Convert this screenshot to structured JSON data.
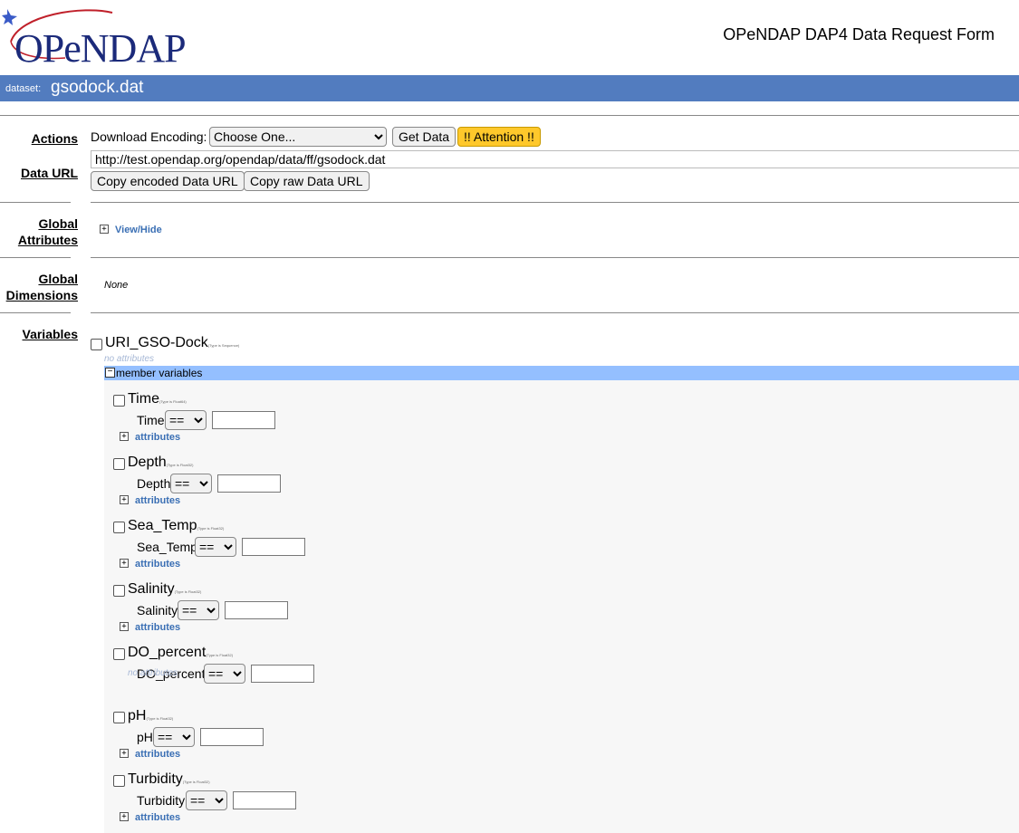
{
  "header": {
    "logo_text": "OPeNDAP",
    "form_title": "OPeNDAP DAP4 Data Request Form"
  },
  "dataset": {
    "label": "dataset:",
    "name": "gsodock.dat"
  },
  "sections": {
    "actions": "Actions",
    "data_url": "Data URL",
    "global_attributes_line1": "Global",
    "global_attributes_line2": "Attributes",
    "global_dimensions_line1": "Global",
    "global_dimensions_line2": "Dimensions",
    "variables": "Variables"
  },
  "actions": {
    "download_encoding_label": "Download Encoding:",
    "encoding_selected": "Choose One...",
    "get_data": "Get Data",
    "attention": "!! Attention !!"
  },
  "data_url": {
    "value": "http://test.opendap.org/opendap/data/ff/gsodock.dat",
    "copy_encoded": "Copy encoded Data URL",
    "copy_raw": "Copy raw Data URL"
  },
  "global_attributes": {
    "toggle_label": "View/Hide",
    "plus": "+"
  },
  "global_dimensions": {
    "value": "None"
  },
  "sequence": {
    "name": "URI_GSO-Dock",
    "type_note": "(Type is Sequence)",
    "no_attributes": "no attributes",
    "member_label": "member variables",
    "member_toggle": "−"
  },
  "variables": [
    {
      "name": "Time",
      "type_note": "(Type is Float64)",
      "op": "==",
      "attributes": "attributes"
    },
    {
      "name": "Depth",
      "type_note": "(Type is Float32)",
      "op": "==",
      "attributes": "attributes"
    },
    {
      "name": "Sea_Temp",
      "type_note": "(Type is Float32)",
      "op": "==",
      "attributes": "attributes"
    },
    {
      "name": "Salinity",
      "type_note": "(Type is Float32)",
      "op": "==",
      "attributes": "attributes"
    },
    {
      "name": "DO_percent",
      "type_note": "(Type is Float32)",
      "op": "==",
      "attributes": "no attributes"
    },
    {
      "name": "pH",
      "type_note": "(Type is Float32)",
      "op": "==",
      "attributes": "attributes"
    },
    {
      "name": "Turbidity",
      "type_note": "(Type is Float32)",
      "op": "==",
      "attributes": "attributes"
    }
  ],
  "colors": {
    "dataset_bar": "#527cbf",
    "member_bar": "#94bfff",
    "attention_button": "#ffc82b",
    "link": "#3a6fb4"
  }
}
